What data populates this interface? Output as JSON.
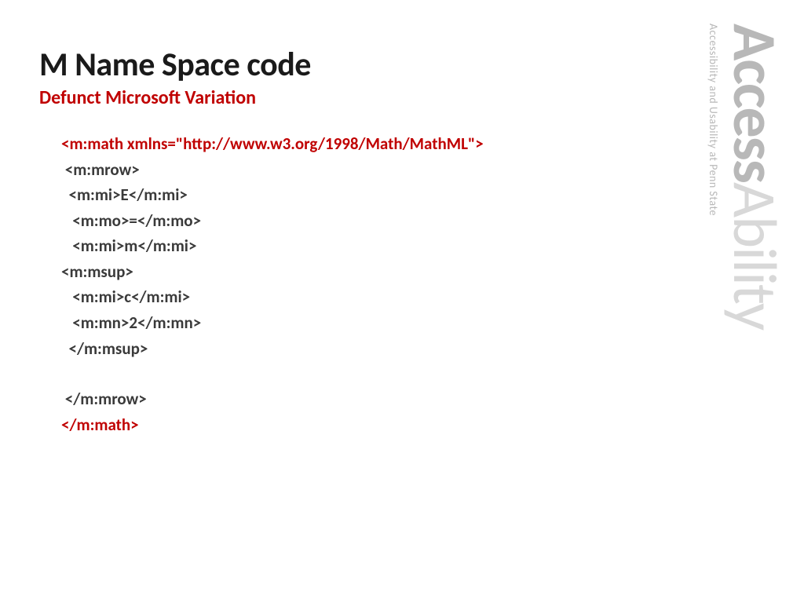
{
  "title": "M Name Space code",
  "subtitle": "Defunct Microsoft Variation",
  "code": {
    "open_tag_prefix": "<m:math ",
    "open_tag_attr": "xmlns=\"http://www.w3.org/1998/Math/MathML\"",
    "open_tag_suffix": ">",
    "line2": " <m:mrow>",
    "line3": "  <m:mi>E</m:mi>",
    "line4": "   <m:mo>=</m:mo>",
    "line5": "   <m:mi>m</m:mi>",
    "line6": "<m:msup>",
    "line7": "   <m:mi>c</m:mi>",
    "line8": "   <m:mn>2</m:mn>",
    "line9": "  </m:msup>",
    "line10": " </m:mrow>",
    "close_tag": "</m:math>"
  },
  "logo": {
    "tagline": "Accessibility and Usability at Penn State",
    "part1": "Access",
    "part2": "Ability"
  }
}
